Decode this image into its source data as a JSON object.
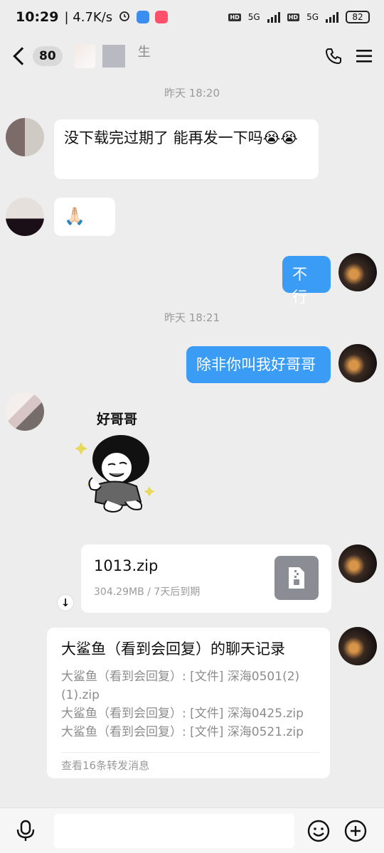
{
  "status": {
    "time": "10:29",
    "speed": "| 4.7K/s",
    "network": "5G",
    "hd": "HD",
    "battery": "82"
  },
  "header": {
    "unread_count": "80",
    "contact_name": "生"
  },
  "chat": {
    "time1": "昨天 18:20",
    "time2": "昨天 18:21",
    "msg1": "没下载完过期了    能再发一下吗😭😭",
    "msg2_emoji": "🙏🏻",
    "msg3": "不行",
    "msg4": "除非你叫我好哥哥",
    "sticker_caption": "好哥哥",
    "file": {
      "name": "1013.zip",
      "meta": "304.29MB / 7天后到期"
    },
    "record": {
      "title": "大鲨鱼（看到会回复）的聊天记录",
      "lines": [
        "大鲨鱼（看到会回复）: [文件] 深海0501(2)(1).zip",
        "大鲨鱼（看到会回复）: [文件] 深海0425.zip",
        "大鲨鱼（看到会回复）: [文件] 深海0521.zip"
      ],
      "footer": "查看16条转发消息"
    }
  },
  "input": {
    "placeholder": ""
  },
  "colors": {
    "accent": "#3b9cf6",
    "background": "#ededed"
  }
}
